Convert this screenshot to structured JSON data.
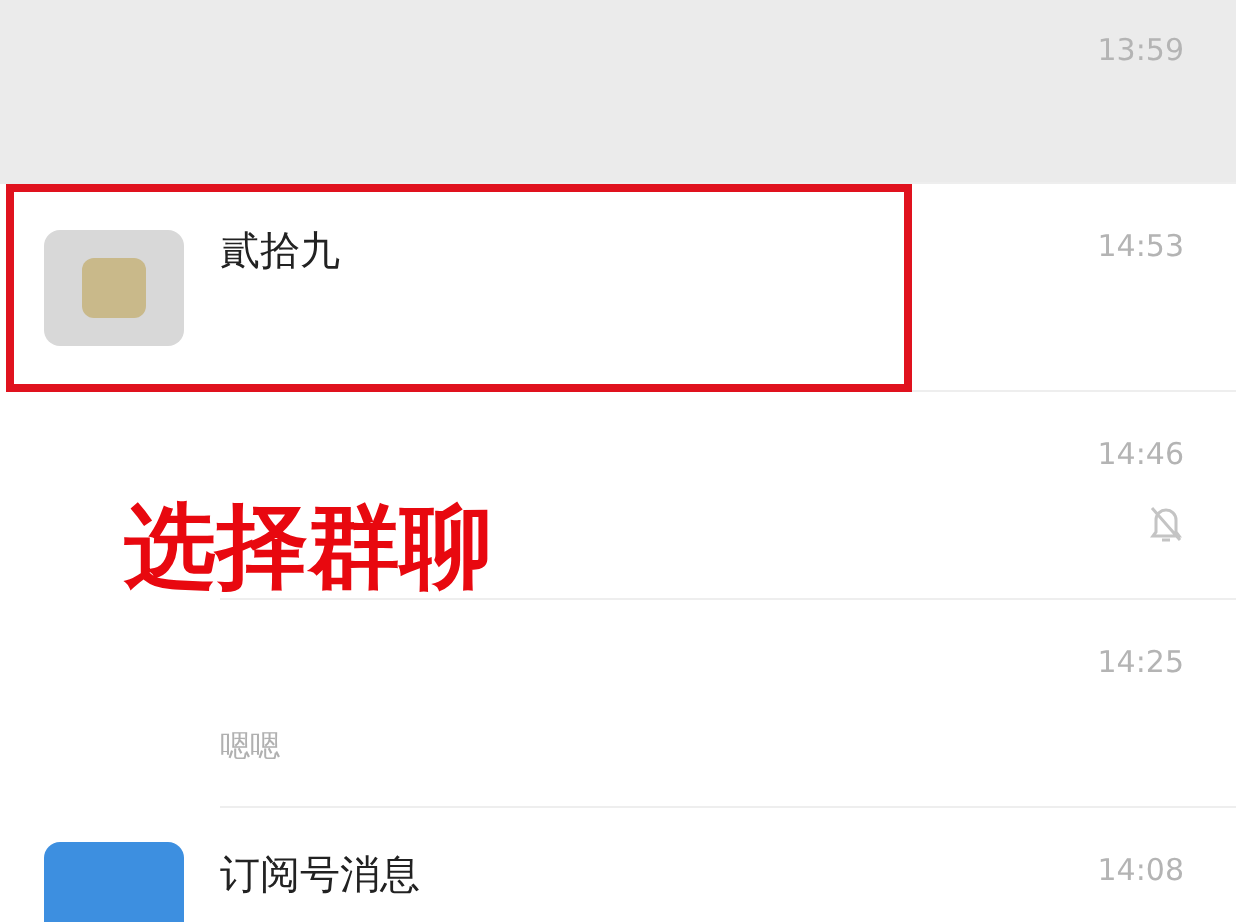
{
  "chats": [
    {
      "kind": "blank",
      "time": "13:59",
      "pinned": true,
      "highlighted": false
    },
    {
      "kind": "photo",
      "name": "貳拾九",
      "time": "14:53",
      "pinned": false,
      "highlighted": true
    },
    {
      "kind": "blank",
      "time": "14:46",
      "muted": true,
      "pinned": false,
      "highlighted": false
    },
    {
      "kind": "blank",
      "time": "14:25",
      "preview": "嗯嗯",
      "pinned": false,
      "highlighted": false
    },
    {
      "kind": "subscription",
      "name": "订阅号消息",
      "time": "14:08",
      "pinned": false,
      "highlighted": false
    }
  ],
  "annotation": {
    "label": "选择群聊"
  }
}
